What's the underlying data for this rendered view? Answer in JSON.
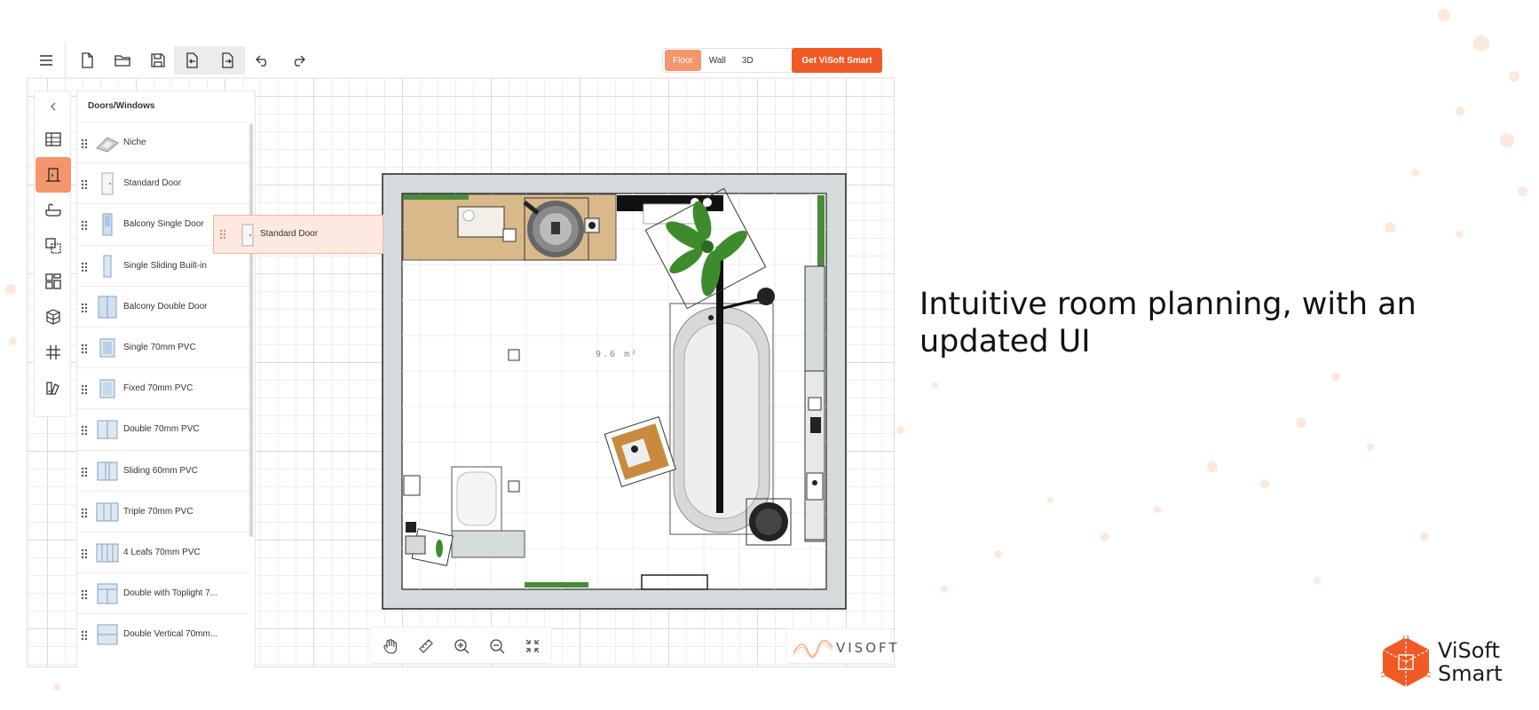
{
  "toolbar": {
    "icons": [
      "menu-icon",
      "new-file-icon",
      "open-folder-icon",
      "save-icon",
      "import-icon",
      "export-icon",
      "undo-icon",
      "redo-icon"
    ]
  },
  "modes": {
    "floor": "Floor",
    "wall": "Wall",
    "view3d": "3D",
    "selected": "Floor"
  },
  "cta": {
    "label": "Get ViSoft Smart"
  },
  "rail": {
    "active": "doors-windows"
  },
  "panel": {
    "title": "Doors/Windows",
    "items": [
      "Niche",
      "Standard Door",
      "Balcony Single Door",
      "Single Sliding Built-in",
      "Balcony Double Door",
      "Single 70mm PVC",
      "Fixed 70mm PVC",
      "Double 70mm PVC",
      "Sliding 60mm PVC",
      "Triple 70mm PVC",
      "4 Leafs 70mm PVC",
      "Double with Toplight 7...",
      "Double Vertical 70mm..."
    ]
  },
  "drag_ghost": {
    "label": "Standard Door"
  },
  "floorplan": {
    "area_label": "9.6 m²"
  },
  "bottom_tools": [
    "pan-icon",
    "measure-icon",
    "zoom-in-icon",
    "zoom-out-icon",
    "fit-icon"
  ],
  "watermark": {
    "text": "VISOFT"
  },
  "headline": "Intuitive room planning, with an updated UI",
  "brand": {
    "line1": "ViSoft",
    "line2": "Smart"
  },
  "colors": {
    "accent": "#f15a24",
    "accent_light": "#f4956b",
    "wall": "#d5dadd"
  }
}
